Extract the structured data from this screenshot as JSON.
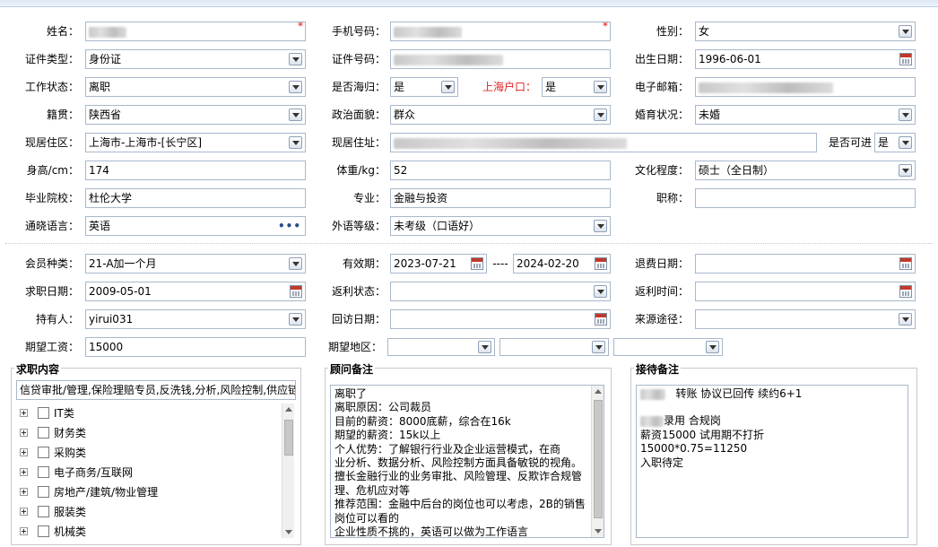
{
  "fields": {
    "name": {
      "label": "姓名：",
      "required": "*"
    },
    "mobile": {
      "label": "手机号码：",
      "required": "*"
    },
    "gender": {
      "label": "性别：",
      "value": "女"
    },
    "id_type": {
      "label": "证件类型：",
      "value": "身份证"
    },
    "id_number": {
      "label": "证件号码："
    },
    "birth_date": {
      "label": "出生日期：",
      "value": "1996-06-01"
    },
    "work_status": {
      "label": "工作状态：",
      "value": "离职"
    },
    "returnee": {
      "label": "是否海归：",
      "value": "是"
    },
    "shanghai_hukou": {
      "label": "上海户口：",
      "value": "是"
    },
    "email": {
      "label": "电子邮箱："
    },
    "native_place": {
      "label": "籍贯：",
      "value": "陕西省"
    },
    "political": {
      "label": "政治面貌：",
      "value": "群众"
    },
    "marital": {
      "label": "婚育状况：",
      "value": "未婚"
    },
    "residence_area": {
      "label": "现居住区：",
      "value": "上海市-上海市-[长宁区]"
    },
    "address": {
      "label": "现居住址："
    },
    "reachable": {
      "label": "是否可进",
      "value": "是"
    },
    "height": {
      "label": "身高/cm：",
      "value": "174"
    },
    "weight": {
      "label": "体重/kg：",
      "value": "52"
    },
    "education": {
      "label": "文化程度：",
      "value": "硕士（全日制）"
    },
    "school": {
      "label": "毕业院校：",
      "value": "杜伦大学"
    },
    "major": {
      "label": "专业：",
      "value": "金融与投资"
    },
    "title": {
      "label": "职称："
    },
    "language": {
      "label": "通晓语言：",
      "value": "英语"
    },
    "foreign_level": {
      "label": "外语等级：",
      "value": "未考级（口语好）"
    },
    "member_type": {
      "label": "会员种类：",
      "value": "21-A加一个月"
    },
    "validity": {
      "label": "有效期：",
      "start": "2023-07-21",
      "sep": "----",
      "end": "2024-02-20"
    },
    "refund_date": {
      "label": "退费日期："
    },
    "job_date": {
      "label": "求职日期：",
      "value": "2009-05-01"
    },
    "rebate_status": {
      "label": "返利状态："
    },
    "rebate_time": {
      "label": "返利时间："
    },
    "holder": {
      "label": "持有人：",
      "value": "yirui031"
    },
    "visit_date": {
      "label": "回访日期："
    },
    "source": {
      "label": "来源途径："
    },
    "salary": {
      "label": "期望工资：",
      "value": "15000"
    },
    "region": {
      "label": "期望地区："
    }
  },
  "job_panel": {
    "title": "求职内容",
    "summary": "信贷审批/管理,保险理赔专员,反洗钱,分析,风险控制,供应链",
    "categories": [
      "IT类",
      "财务类",
      "采购类",
      "电子商务/互联网",
      "房地产/建筑/物业管理",
      "服装类",
      "机械类"
    ]
  },
  "advisor_panel": {
    "title": "顾问备注",
    "lines": [
      "离职了",
      "离职原因：公司裁员",
      "目前的薪资：8000底薪，综合在16k",
      "期望的薪资：15k以上",
      "个人优势：了解银行行业及企业运营模式，在商",
      "业分析、数据分析、风险控制方面具备敏锐的视角。",
      "擅长金融行业的业务审批、风险管理、反欺诈合规管",
      "理、危机应对等",
      "推荐范围：金融中后台的岗位也可以考虑，2B的销售",
      "岗位可以看的",
      "企业性质不挑的，英语可以做为工作语言"
    ]
  },
  "reception_panel": {
    "title": "接待备注",
    "line1": "转账   协议已回传  续约6+1",
    "line2": "录用  合规岗",
    "line3": "薪资15000  试用期不打折",
    "line4": "15000*0.75=11250",
    "line5": "入职待定"
  }
}
